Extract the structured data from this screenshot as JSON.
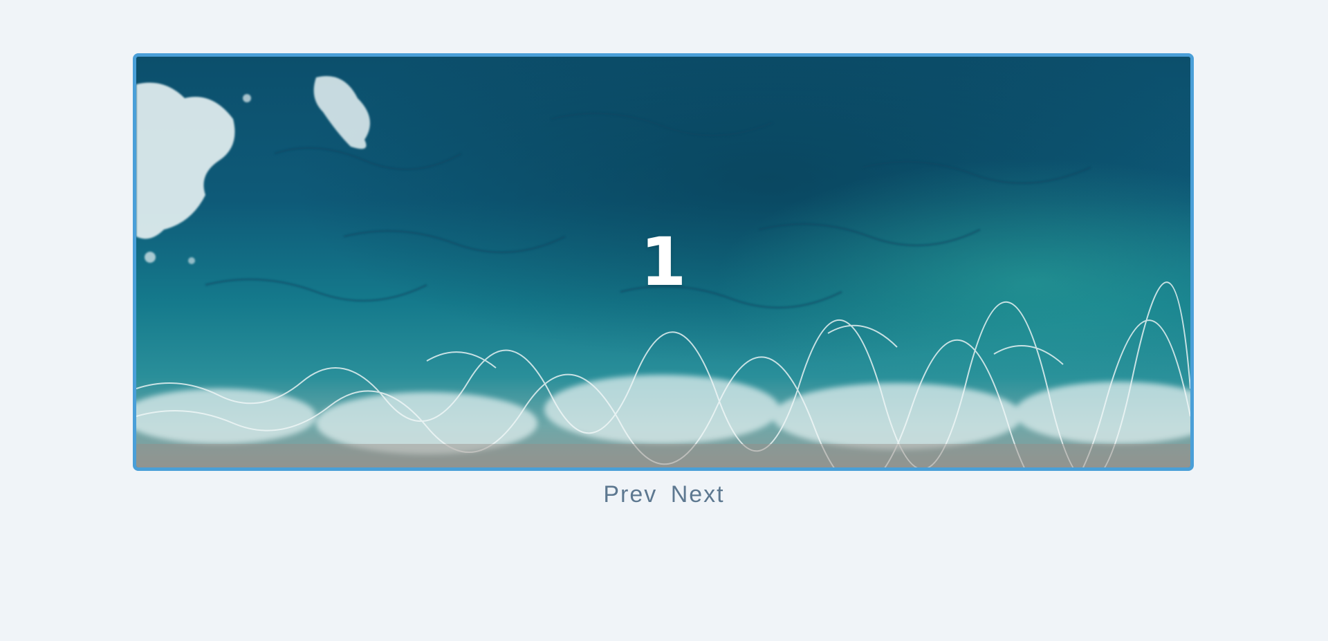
{
  "carousel": {
    "current_slide_label": "1",
    "accent_color": "#4a9fd8",
    "image_description": "ocean-waves-aerial"
  },
  "controls": {
    "prev_label": "Prev",
    "next_label": "Next"
  }
}
